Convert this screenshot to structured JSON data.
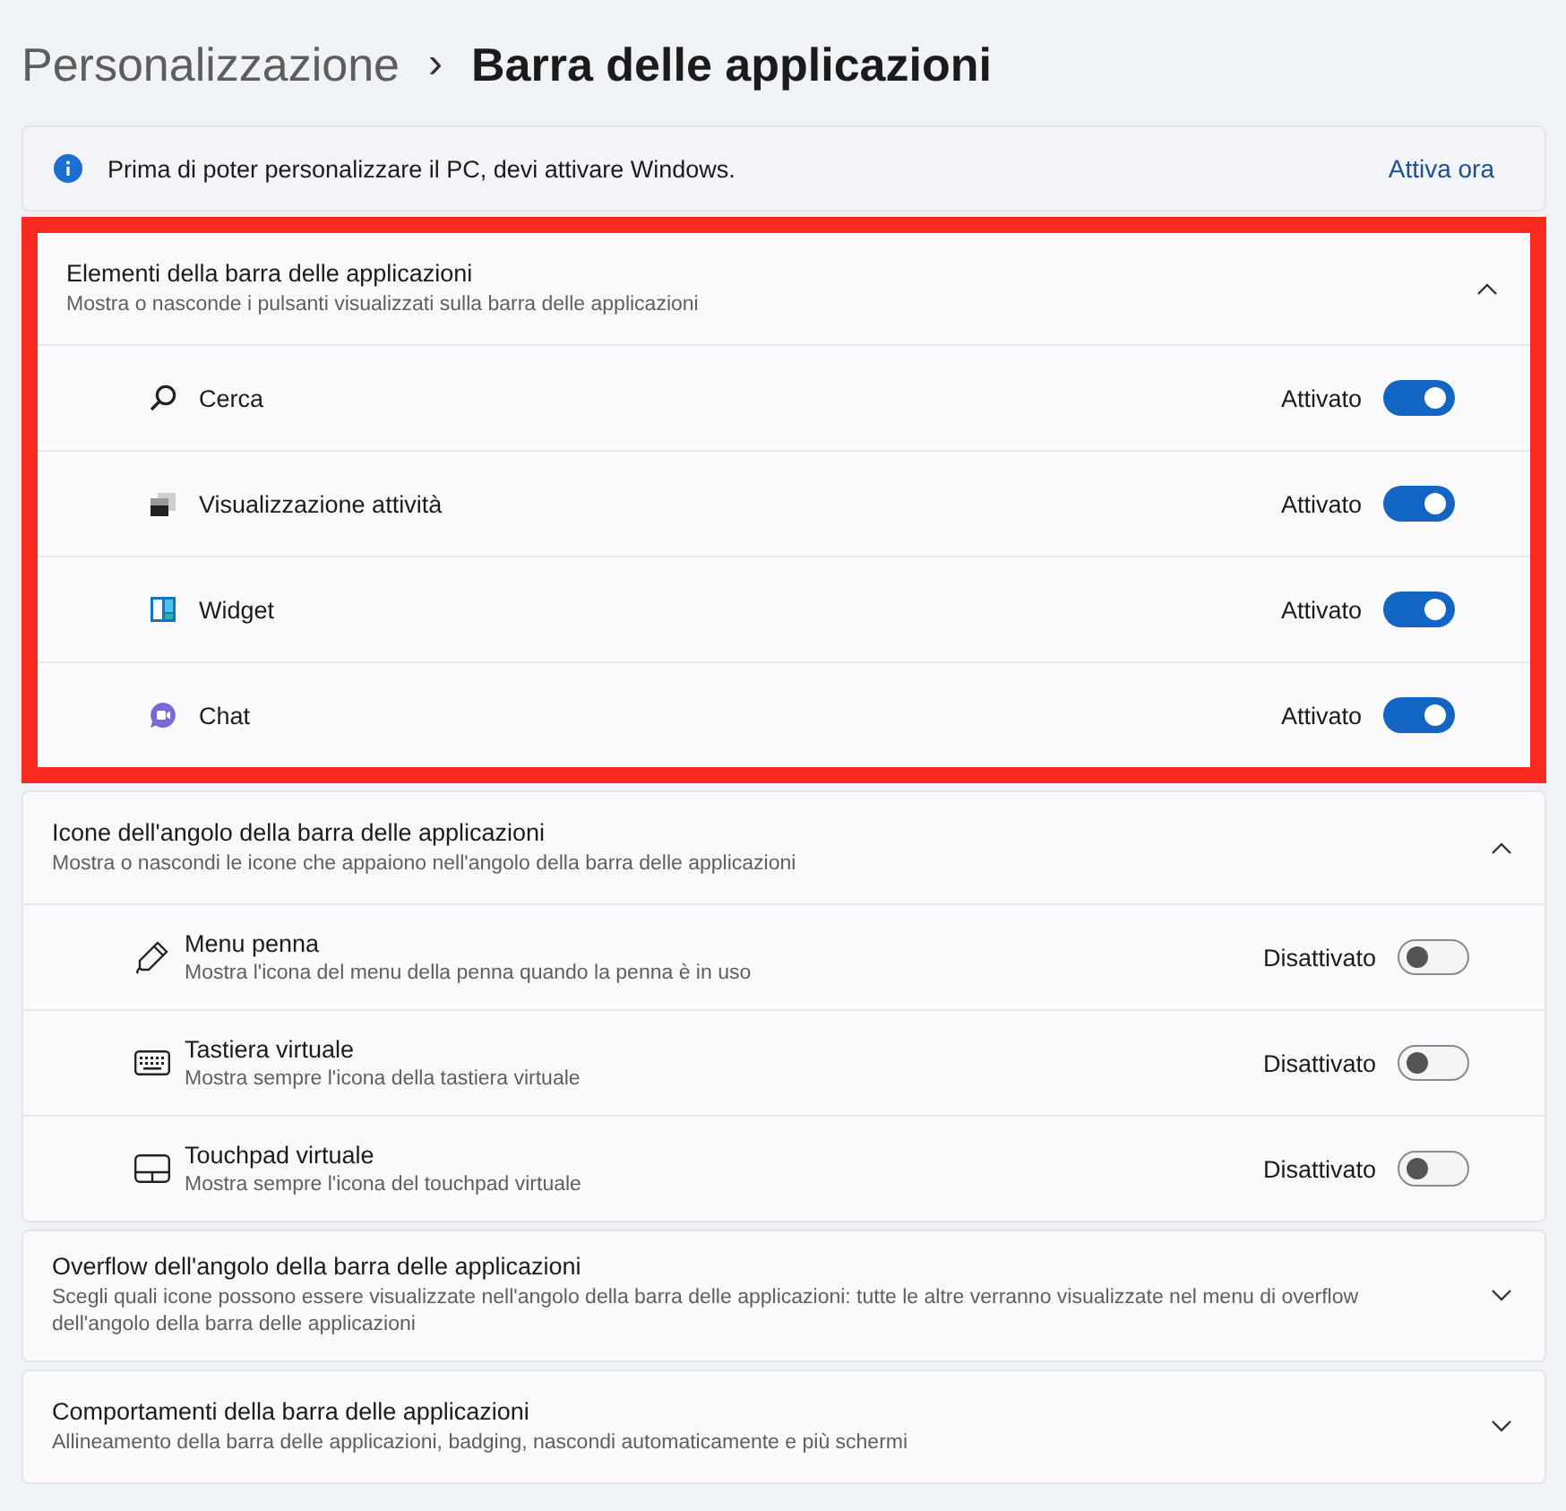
{
  "breadcrumb": {
    "parent": "Personalizzazione",
    "separator": "›",
    "current": "Barra delle applicazioni"
  },
  "banner": {
    "message": "Prima di poter personalizzare il PC, devi attivare Windows.",
    "link": "Attiva ora"
  },
  "sections": [
    {
      "title": "Elementi della barra delle applicazioni",
      "description": "Mostra o nasconde i pulsanti visualizzati sulla barra delle applicazioni",
      "expanded": true,
      "highlighted": true,
      "items": [
        {
          "label": "Cerca",
          "state_label": "Attivato",
          "on": true
        },
        {
          "label": "Visualizzazione attività",
          "state_label": "Attivato",
          "on": true
        },
        {
          "label": "Widget",
          "state_label": "Attivato",
          "on": true
        },
        {
          "label": "Chat",
          "state_label": "Attivato",
          "on": true
        }
      ]
    },
    {
      "title": "Icone dell'angolo della barra delle applicazioni",
      "description": "Mostra o nascondi le icone che appaiono nell'angolo della barra delle applicazioni",
      "expanded": true,
      "highlighted": false,
      "items": [
        {
          "label": "Menu penna",
          "description": "Mostra l'icona del menu della penna quando la penna è in uso",
          "state_label": "Disattivato",
          "on": false
        },
        {
          "label": "Tastiera virtuale",
          "description": "Mostra sempre l'icona della tastiera virtuale",
          "state_label": "Disattivato",
          "on": false
        },
        {
          "label": "Touchpad virtuale",
          "description": "Mostra sempre l'icona del touchpad virtuale",
          "state_label": "Disattivato",
          "on": false
        }
      ]
    },
    {
      "title": "Overflow dell'angolo della barra delle applicazioni",
      "description": "Scegli quali icone possono essere visualizzate nell'angolo della barra delle applicazioni: tutte le altre verranno visualizzate nel menu di overflow dell'angolo della barra delle applicazioni",
      "expanded": false,
      "highlighted": false
    },
    {
      "title": "Comportamenti della barra delle applicazioni",
      "description": "Allineamento della barra delle applicazioni, badging, nascondi automaticamente e più schermi",
      "expanded": false,
      "highlighted": false
    }
  ]
}
